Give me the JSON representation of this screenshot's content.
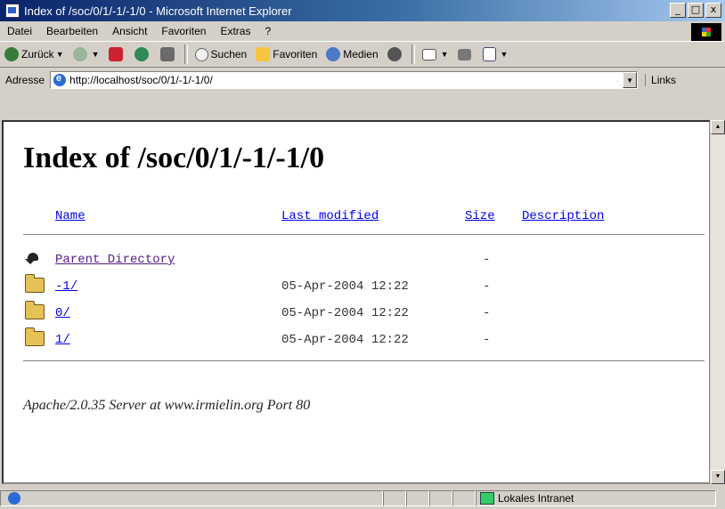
{
  "window": {
    "title": "Index of /soc/0/1/-1/-1/0 - Microsoft Internet Explorer",
    "buttons": [
      "_",
      "□",
      "x"
    ]
  },
  "menu": [
    "Datei",
    "Bearbeiten",
    "Ansicht",
    "Favoriten",
    "Extras",
    "?"
  ],
  "toolbar": {
    "back": "Zurück",
    "search": "Suchen",
    "favorites": "Favoriten",
    "media": "Medien"
  },
  "address": {
    "label": "Adresse",
    "value": "http://localhost/soc/0/1/-1/-1/0/",
    "links": "Links"
  },
  "page": {
    "heading": "Index of /soc/0/1/-1/-1/0",
    "columns": {
      "name": "Name",
      "last_modified": "Last modified",
      "size": "Size",
      "description": "Description"
    },
    "rows": [
      {
        "name": "Parent Directory",
        "date": "",
        "size": "-",
        "icon": "back-arrow-icon"
      },
      {
        "name": "-1/",
        "date": "05-Apr-2004 12:22",
        "size": "-",
        "icon": "folder-icon"
      },
      {
        "name": "0/",
        "date": "05-Apr-2004 12:22",
        "size": "-",
        "icon": "folder-icon"
      },
      {
        "name": "1/",
        "date": "05-Apr-2004 12:22",
        "size": "-",
        "icon": "folder-icon"
      }
    ],
    "server_signature": "Apache/2.0.35 Server at www.irmielin.org Port 80"
  },
  "status": {
    "zone": "Lokales Intranet"
  }
}
